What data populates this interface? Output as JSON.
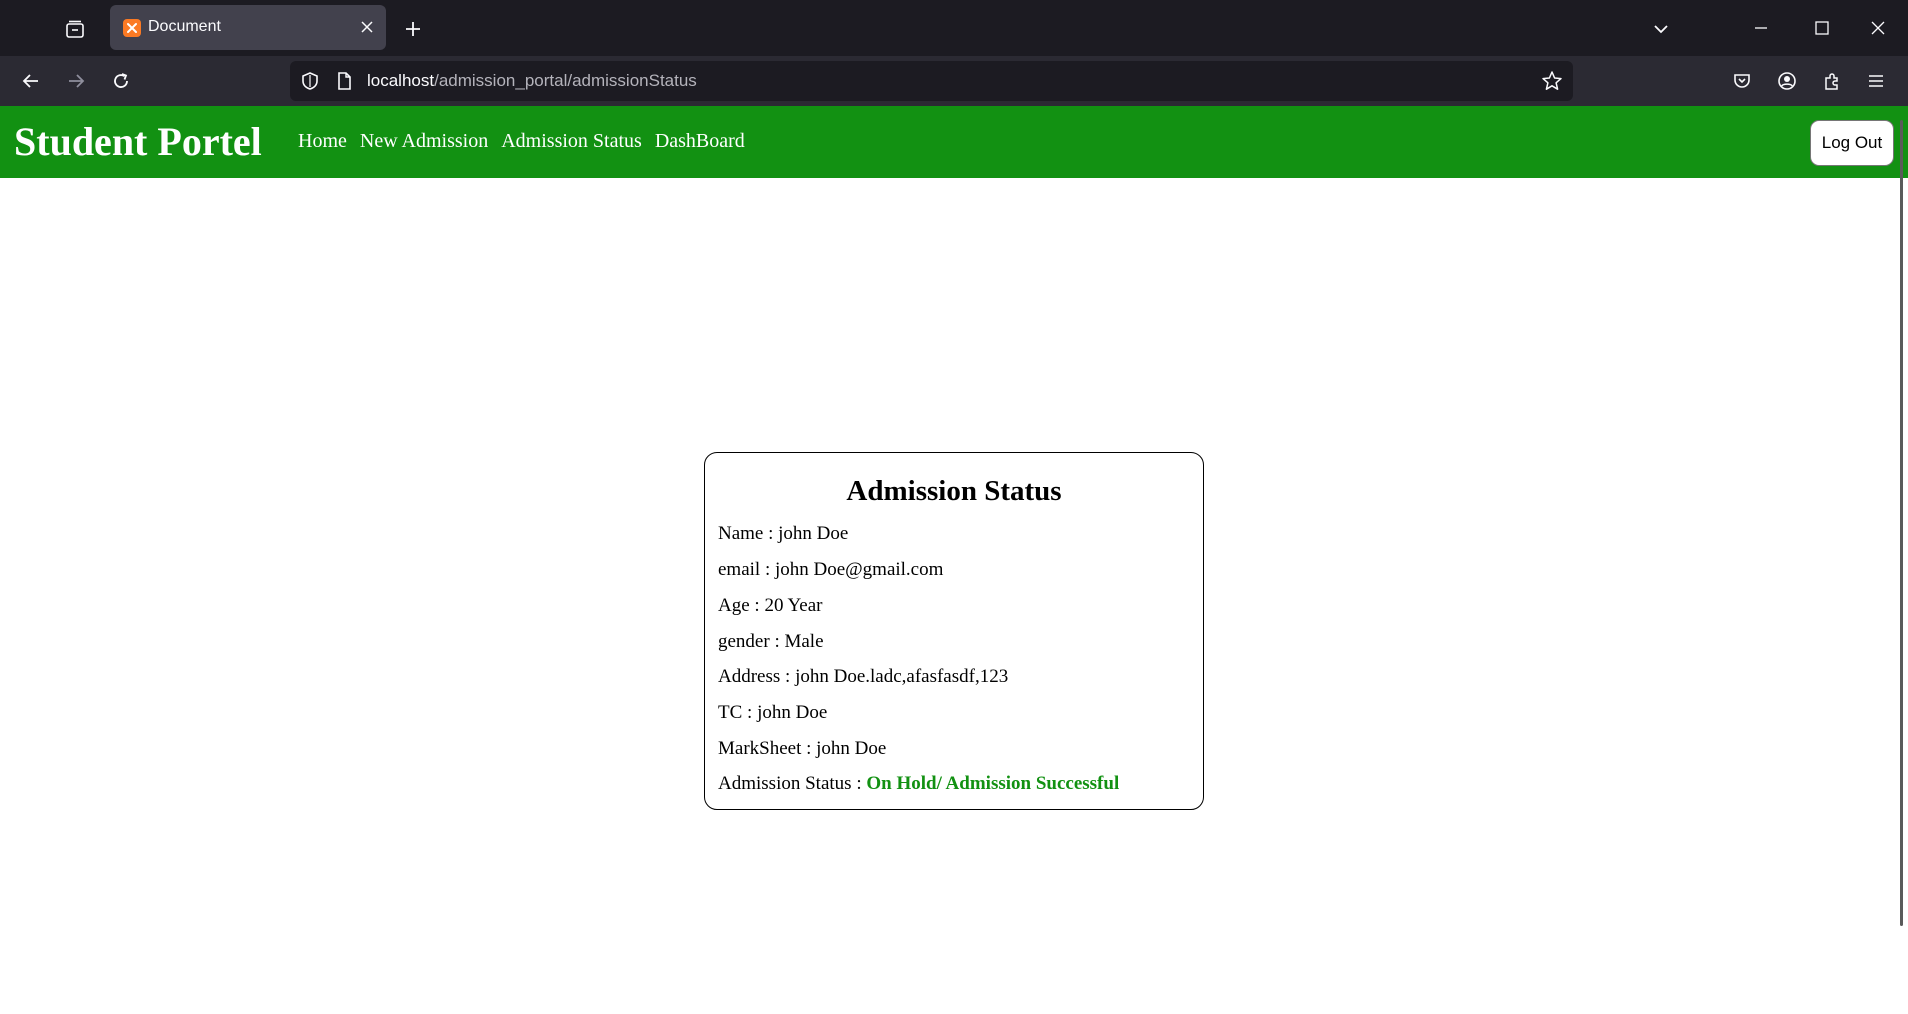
{
  "browser": {
    "tab_title": "Document",
    "url_host": "localhost",
    "url_path": "/admission_portal/admissionStatus"
  },
  "site": {
    "brand": "Student Portel",
    "menu": [
      "Home",
      "New Admission",
      "Admission Status",
      "DashBoard"
    ],
    "logout_label": "Log Out",
    "header_color": "#129112"
  },
  "card": {
    "title": "Admission Status",
    "fields": [
      {
        "label": "Name",
        "value": "john Doe"
      },
      {
        "label": "email",
        "value": "john Doe@gmail.com"
      },
      {
        "label": "Age",
        "value": "20 Year"
      },
      {
        "label": "gender",
        "value": "Male"
      },
      {
        "label": "Address",
        "value": "john Doe.ladc,afasfasdf,123"
      },
      {
        "label": "TC",
        "value": "john Doe"
      },
      {
        "label": "MarkSheet",
        "value": "john Doe"
      }
    ],
    "status_label": "Admission Status",
    "status_value": "On Hold/ Admission Successful",
    "status_color": "#129112"
  },
  "icons": {
    "tab_strip": "tab-strip-icon",
    "favicon": "xampp-favicon-icon",
    "tab_close": "close-icon",
    "new_tab": "plus-icon",
    "list_all_tabs": "chevron-down-icon",
    "minimize": "minimize-icon",
    "maximize": "maximize-icon",
    "close_window": "close-icon",
    "back": "arrow-left-icon",
    "forward": "arrow-right-icon",
    "reload": "reload-icon",
    "shield": "shield-icon",
    "page": "page-icon",
    "bookmark": "star-icon",
    "pocket": "pocket-icon",
    "account": "account-icon",
    "extensions": "puzzle-icon",
    "menu": "hamburger-icon"
  }
}
